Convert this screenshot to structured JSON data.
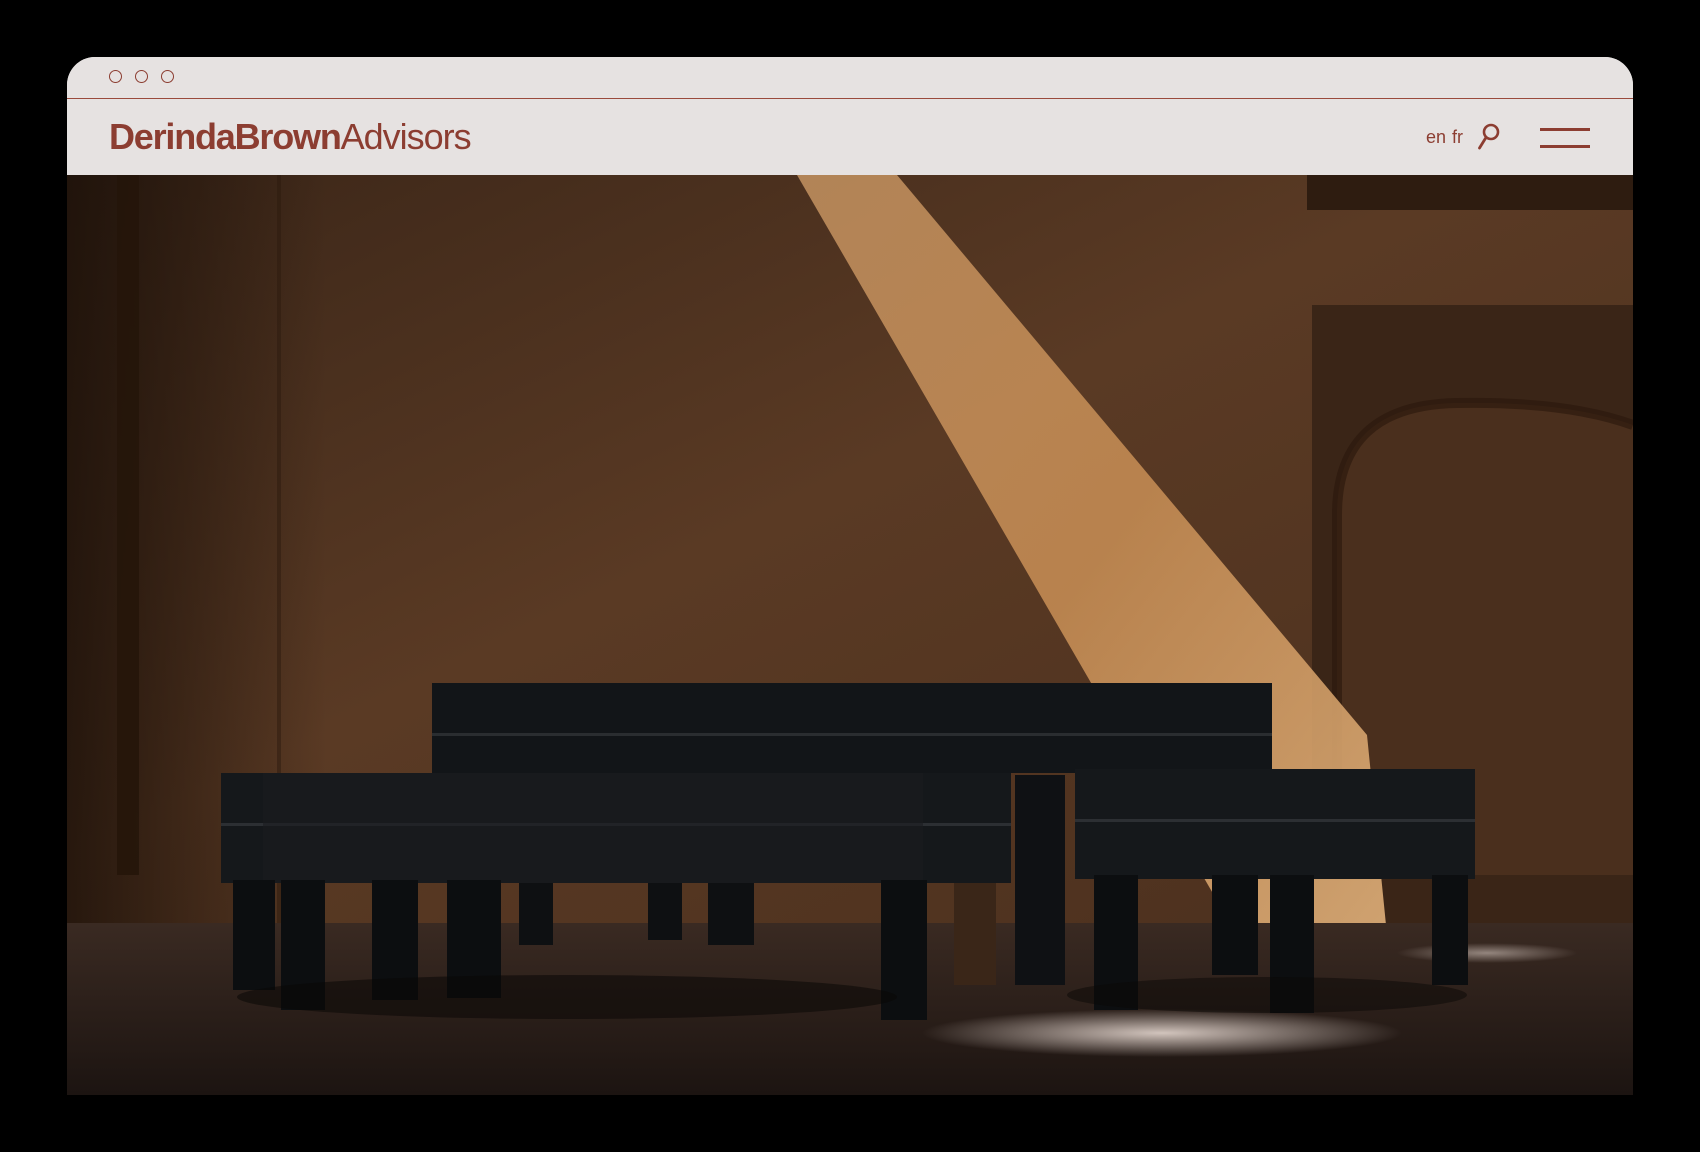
{
  "window": {
    "controls": [
      "close",
      "minimize",
      "maximize"
    ]
  },
  "header": {
    "logo_bold": "DerindaBrown",
    "logo_light": "Advisors",
    "languages": [
      "en",
      "fr"
    ],
    "search_icon": "search-icon",
    "menu_icon": "hamburger-menu-icon"
  },
  "hero": {
    "image": "photo of dark wooden benches against an earthen wall with a diagonal beam of sunlight"
  },
  "colors": {
    "brand": "#8c3d31",
    "chrome_bg": "#e6e2e1",
    "outer_bg": "#000000"
  }
}
